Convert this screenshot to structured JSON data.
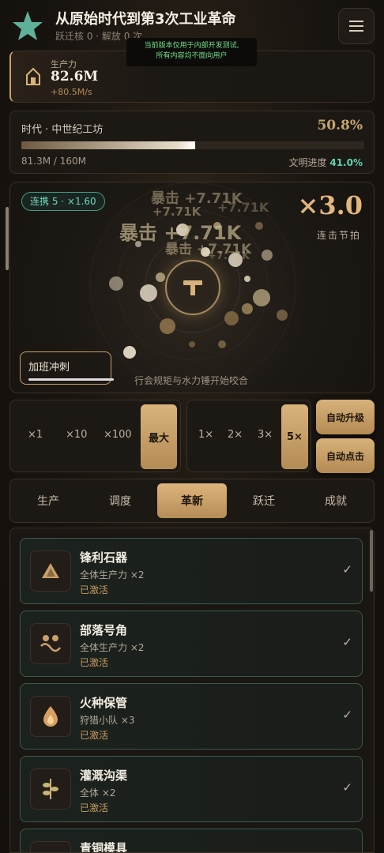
{
  "header": {
    "title": "从原始时代到第3次工业革命",
    "subtitle": "跃迁核 0 · 解放 0 次",
    "notice_line1": "当前版本仅用于内部开发测试,",
    "notice_line2": "所有内容均不面向用户"
  },
  "production": {
    "label": "生产力",
    "value": "82.6M",
    "rate": "+80.5M/s"
  },
  "era": {
    "label": "时代 · 中世纪工坊",
    "percent_text": "50.8%",
    "progress": 0.508,
    "amount": "81.3M / 160M",
    "civ_label": "文明进度",
    "civ_value": "41.0%"
  },
  "stage": {
    "combo_chip": "连携 5 · ×1.60",
    "multiplier": "×3.0",
    "multiplier_label": "连击节拍",
    "floating": [
      "暴击 +7.71K",
      "+7.71K",
      "暴击 +7.71K",
      "+7.71K",
      "暴击 +7.71K",
      "+7.71K"
    ],
    "boost_label": "加班冲刺",
    "boost_progress": 0.95,
    "caption": "行会规矩与水力锤开始咬合"
  },
  "buy_amounts": {
    "options": [
      "×1",
      "×10",
      "×100"
    ],
    "active": "最大"
  },
  "speed": {
    "options": [
      "1×",
      "2×",
      "3×"
    ],
    "active": "5×"
  },
  "auto": {
    "upgrade": "自动升级",
    "click": "自动点击"
  },
  "tabs": {
    "production": "生产",
    "dispatch": "调度",
    "innovation": "革新",
    "leap": "跃迁",
    "achievements": "成就"
  },
  "upgrades": [
    {
      "name": "锋利石器",
      "desc": "全体生产力 ×2",
      "status": "已激活",
      "icon": "stone-tool-icon"
    },
    {
      "name": "部落号角",
      "desc": "全体生产力 ×2",
      "status": "已激活",
      "icon": "tribe-horn-icon"
    },
    {
      "name": "火种保管",
      "desc": "狩猎小队 ×3",
      "status": "已激活",
      "icon": "flame-icon"
    },
    {
      "name": "灌溉沟渠",
      "desc": "全体 ×2",
      "status": "已激活",
      "icon": "sprout-icon"
    },
    {
      "name": "青铜模具",
      "desc": "",
      "status": "",
      "icon": "mold-icon"
    }
  ],
  "colors": {
    "accent_gold": "#c8a06a",
    "teal": "#5fd3b0",
    "bg": "#17130f"
  }
}
